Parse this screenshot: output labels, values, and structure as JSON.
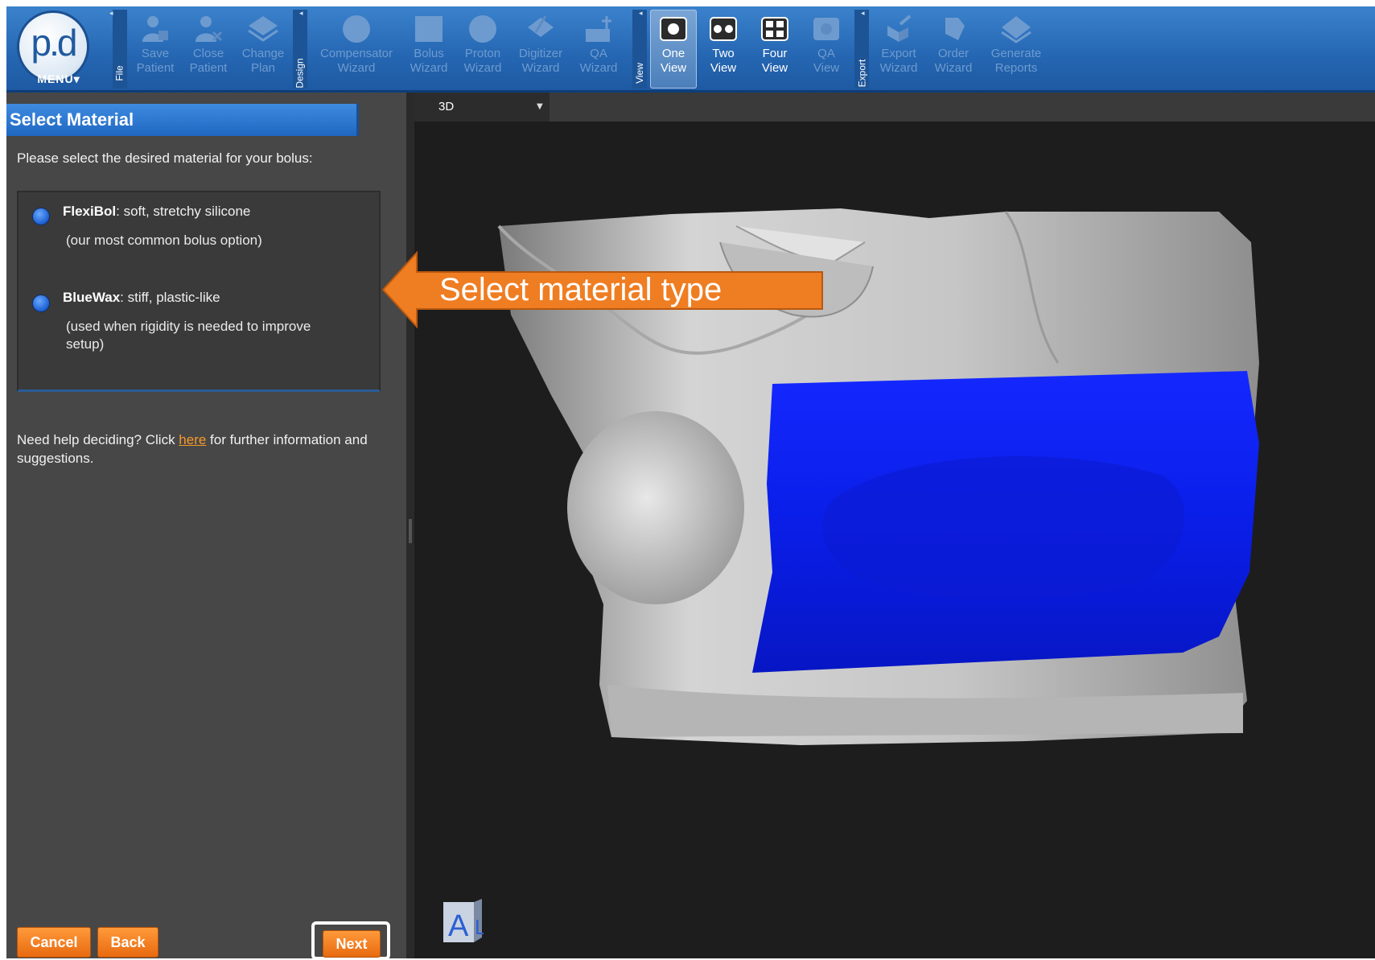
{
  "toolbar": {
    "menu": {
      "logo": "p.d",
      "label": "MENU▾"
    },
    "groups": {
      "file": "File",
      "design": "Design",
      "view": "View",
      "export": "Export"
    },
    "buttons": {
      "save_patient": [
        "Save",
        "Patient"
      ],
      "close_patient": [
        "Close",
        "Patient"
      ],
      "change_plan": [
        "Change",
        "Plan"
      ],
      "compensator_wizard": [
        "Compensator",
        "Wizard"
      ],
      "bolus_wizard": [
        "Bolus",
        "Wizard"
      ],
      "proton_wizard": [
        "Proton",
        "Wizard"
      ],
      "digitizer_wizard": [
        "Digitizer",
        "Wizard"
      ],
      "qa_wizard": [
        "QA",
        "Wizard"
      ],
      "one_view": [
        "One",
        "View"
      ],
      "two_view": [
        "Two",
        "View"
      ],
      "four_view": [
        "Four",
        "View"
      ],
      "qa_view": [
        "QA",
        "View"
      ],
      "export_wizard": [
        "Export",
        "Wizard"
      ],
      "order_wizard": [
        "Order",
        "Wizard"
      ],
      "generate_reports": [
        "Generate",
        "Reports"
      ]
    }
  },
  "panel": {
    "title": "Select Material",
    "prompt": "Please select the desired material for your bolus:",
    "options": [
      {
        "name": "FlexiBol",
        "desc": ": soft, stretchy silicone",
        "note": "(our most common bolus option)"
      },
      {
        "name": "BlueWax",
        "desc": ": stiff, plastic-like",
        "note": "(used when rigidity is needed to improve setup)"
      }
    ],
    "help_prefix": "Need help deciding? Click ",
    "help_link": "here",
    "help_suffix": " for further information and suggestions.",
    "buttons": {
      "cancel": "Cancel",
      "back": "Back",
      "next": "Next"
    }
  },
  "viewport": {
    "view_mode": "3D",
    "orientation_cube": {
      "front": "A",
      "side": "L"
    }
  },
  "callout": {
    "text": "Select material type",
    "color": "#ef7d22"
  },
  "colors": {
    "accent_blue": "#1f67c2",
    "button_orange": "#f07e22",
    "bolus_blue": "#0a1ee8",
    "panel_bg": "#474747"
  }
}
